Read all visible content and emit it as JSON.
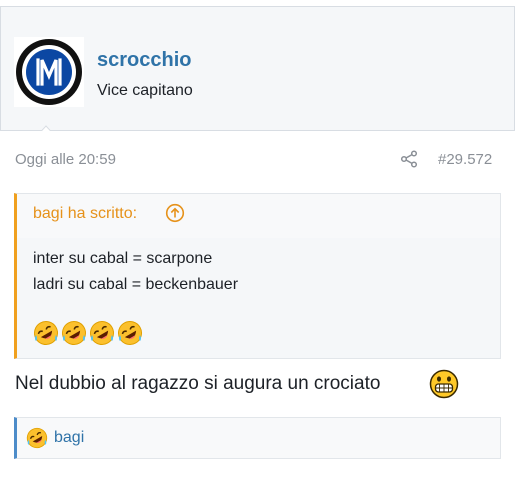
{
  "user": {
    "name": "scrocchio",
    "title": "Vice capitano",
    "avatar_icon": "inter-logo-icon"
  },
  "post": {
    "date": "Oggi alle 20:59",
    "number": "#29.572",
    "share_icon": "share-icon"
  },
  "quote": {
    "author": "bagi ha scritto:",
    "lines": [
      "inter su cabal = scarpone",
      "ladri su cabal = beckenbauer"
    ],
    "emoji_icon": "rolling-laughing-emoji-icon",
    "emoji_count": 4
  },
  "message": {
    "text": "Nel dubbio al ragazzo si augura un crociato",
    "emoji_icon": "grimace-emoji-icon"
  },
  "reactions": {
    "emoji_icon": "rolling-laughing-emoji-icon",
    "users": "bagi"
  },
  "colors": {
    "link": "#2f73a8",
    "quote_accent": "#f0a01e",
    "reaction_accent": "#4d8cc9",
    "muted": "#8a8f96"
  }
}
